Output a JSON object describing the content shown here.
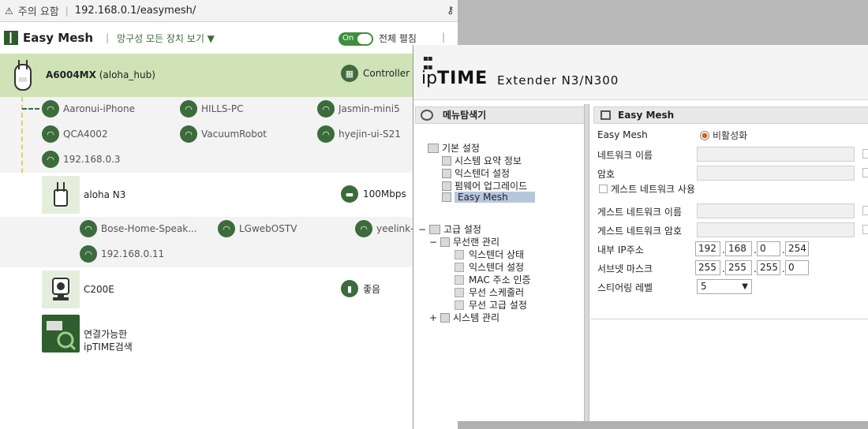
{
  "browser": {
    "warning": "주의 요함",
    "url": "192.168.0.1/easymesh/"
  },
  "easymesh": {
    "title": "Easy Mesh",
    "filter": "망구성 모든 장치 보기 ▼",
    "toggle": "On",
    "expand": "전체 펼침",
    "hub": {
      "model": "A6004MX",
      "alias": "(aloha_hub)",
      "role": "Controller"
    },
    "hub_clients": [
      "Aaronui-iPhone",
      "HILLS-PC",
      "Jasmin-mini5",
      "QCA4002",
      "VacuumRobot",
      "hyejin-ui-S21",
      "192.168.0.3"
    ],
    "n3": {
      "name": "aloha N3",
      "speed": "100Mbps"
    },
    "n3_clients": [
      "Bose-Home-Speak...",
      "LGwebOSTV",
      "yeelink-li",
      "192.168.0.11"
    ],
    "c200": {
      "name": "C200E",
      "signal": "좋음"
    },
    "search": {
      "line1": "연결가능한",
      "line2": "ipTIME검색"
    }
  },
  "admin": {
    "brand_ip": "ip",
    "brand_time": "TIME",
    "model": "Extender N3/N300",
    "menu_title": "메뉴탐색기",
    "menu": {
      "basic": "기본 설정",
      "basic_items": [
        "시스템 요약 정보",
        "익스텐더 설정",
        "펌웨어 업그레이드",
        "Easy Mesh"
      ],
      "advanced": "고급 설정",
      "wireless": "무선랜 관리",
      "wireless_items": [
        "익스텐더 상태",
        "익스텐더 설정",
        "MAC 주소 인증",
        "무선 스케줄러",
        "무선 고급 설정"
      ],
      "system": "시스템 관리"
    },
    "content": {
      "title": "Easy Mesh",
      "easymesh_label": "Easy Mesh",
      "easymesh_value": "비활성화",
      "network_name": "네트워크 이름",
      "password": "암호",
      "guest_use": "게스트 네트워크 사용",
      "guest_name": "게스트 네트워크 이름",
      "guest_pw": "게스트 네트워크 암호",
      "internal_ip": "내부 IP주소",
      "ip": [
        "192",
        "168",
        "0",
        "254"
      ],
      "subnet": "서브넷 마스크",
      "mask": [
        "255",
        "255",
        "255",
        "0"
      ],
      "steering": "스티어링 레벨",
      "steering_value": "5"
    }
  }
}
